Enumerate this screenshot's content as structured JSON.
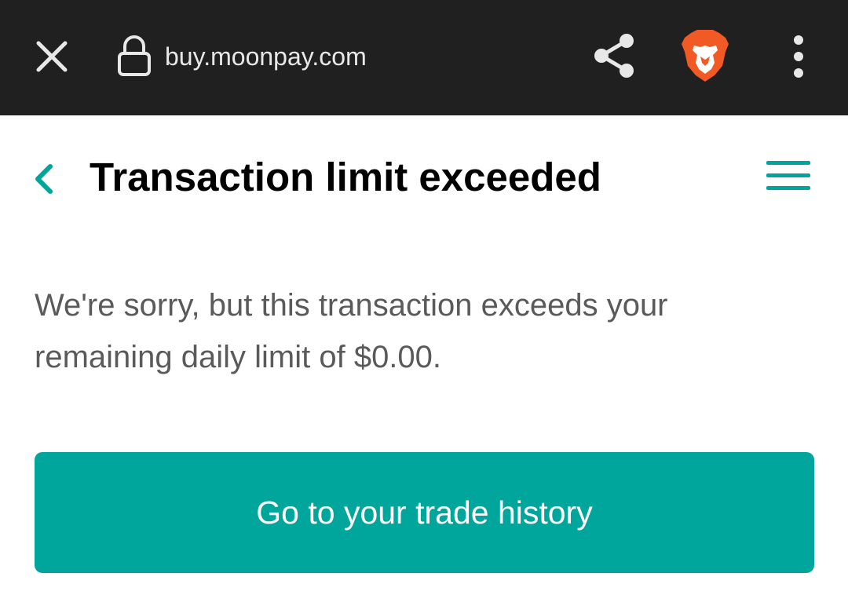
{
  "browser": {
    "url": "buy.moonpay.com",
    "icons": {
      "close": "close-icon",
      "lock": "lock-icon",
      "share": "share-icon",
      "brave": "brave-lion-icon",
      "more": "more-vert-icon"
    },
    "bar_color": "#202020"
  },
  "header": {
    "title": "Transaction limit exceeded",
    "icons": {
      "back": "chevron-left-icon",
      "menu": "hamburger-menu-icon"
    },
    "accent_color": "#00a69c"
  },
  "body": {
    "message": "We're sorry, but this transaction exceeds your remaining daily limit of $0.00."
  },
  "action": {
    "button_label": "Go to your trade history",
    "button_color": "#00a69c"
  }
}
